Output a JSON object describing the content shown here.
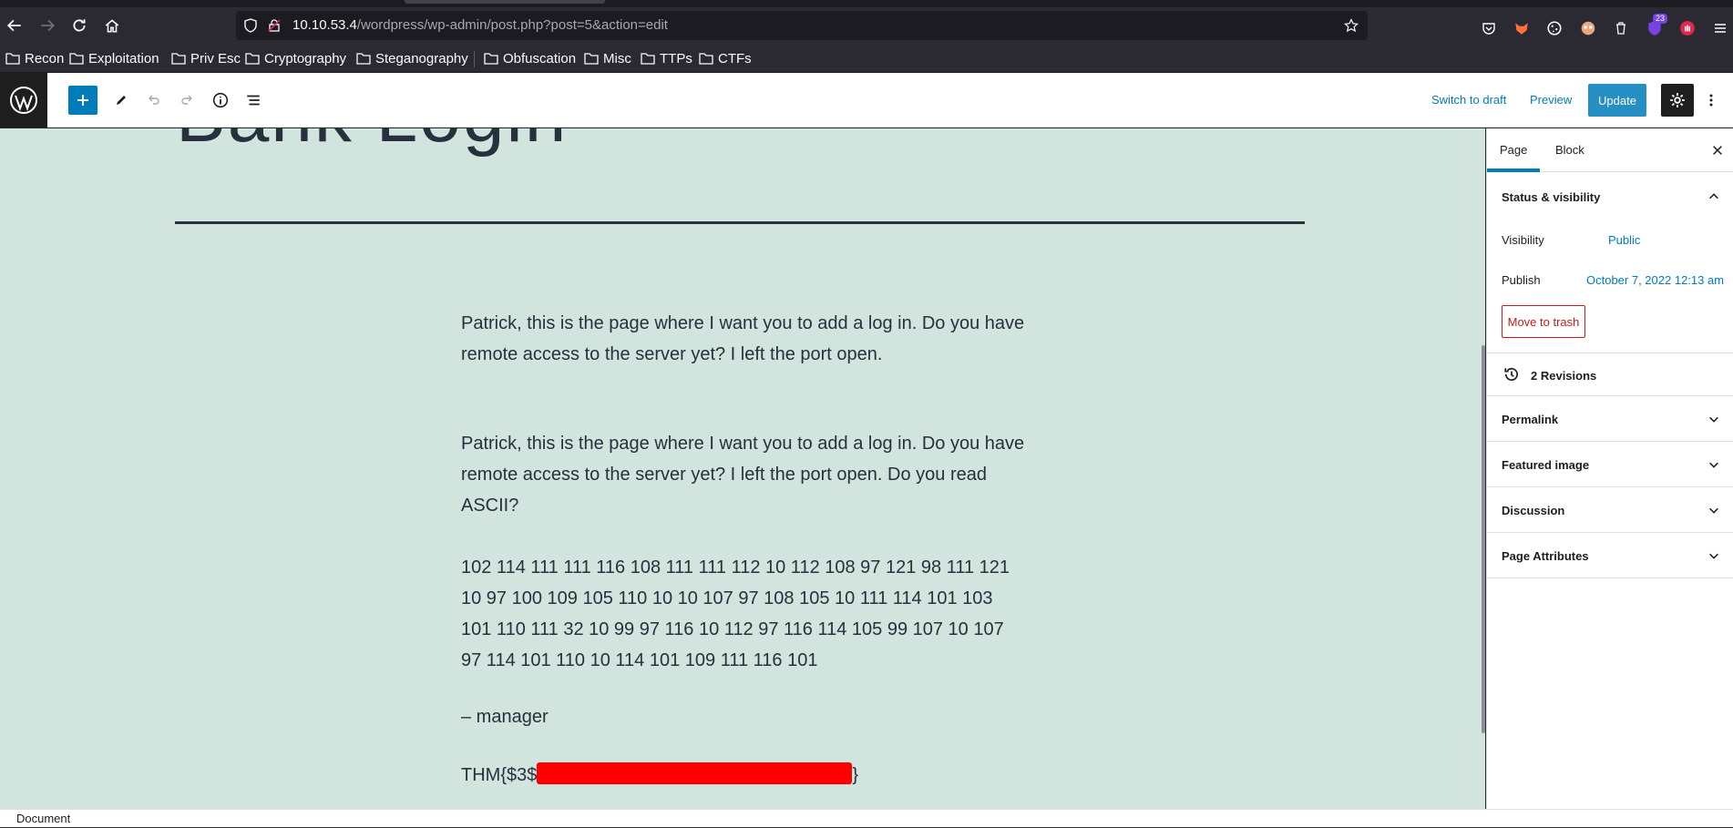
{
  "browser": {
    "url_host": "10.10.53.4",
    "url_path": "/wordpress/wp-admin/post.php?post=5&action=edit",
    "extension_badge": "23",
    "bookmarks": [
      "Recon",
      "Exploitation",
      "Priv Esc",
      "Cryptography",
      "Steganography",
      "Obfuscation",
      "Misc",
      "TTPs",
      "CTFs"
    ]
  },
  "editor": {
    "switch_to_draft": "Switch to draft",
    "preview": "Preview",
    "update": "Update"
  },
  "content": {
    "title": "Bank Login",
    "para1": "Patrick, this is the page where I want you to add a log in. Do you have remote access to the server yet? I left the port open.",
    "para2": "Patrick, this is the page where I want you to add a log in. Do you have remote access to the server yet? I left the port open. Do you read ASCII?",
    "ascii_codes": "102 114 111 111 116 108 111 111 112 10 112 108 97 121 98 111 121 10 97 100 109 105 110 10 10 107 97 108 105 10 111 114 101 103 101 110 111 32 10 99 97 116 10 112 97 116 114 105 99 107 10 107 97 114 101 110 10 114 101 109 111 116 101",
    "signature": "– manager",
    "flag_prefix": "THM{$3$",
    "flag_suffix": "}"
  },
  "sidebar": {
    "tabs": [
      "Page",
      "Block"
    ],
    "status_title": "Status & visibility",
    "visibility_label": "Visibility",
    "visibility_value": "Public",
    "publish_label": "Publish",
    "publish_value": "October 7, 2022 12:13 am",
    "trash": "Move to trash",
    "revisions": "2 Revisions",
    "panels": [
      "Permalink",
      "Featured image",
      "Discussion",
      "Page Attributes"
    ]
  },
  "footer": {
    "breadcrumb": "Document"
  },
  "colors": {
    "accent": "#007cba",
    "canvas_bg": "#d1e4dd",
    "danger": "#cc1818",
    "redaction": "#ff0000"
  }
}
